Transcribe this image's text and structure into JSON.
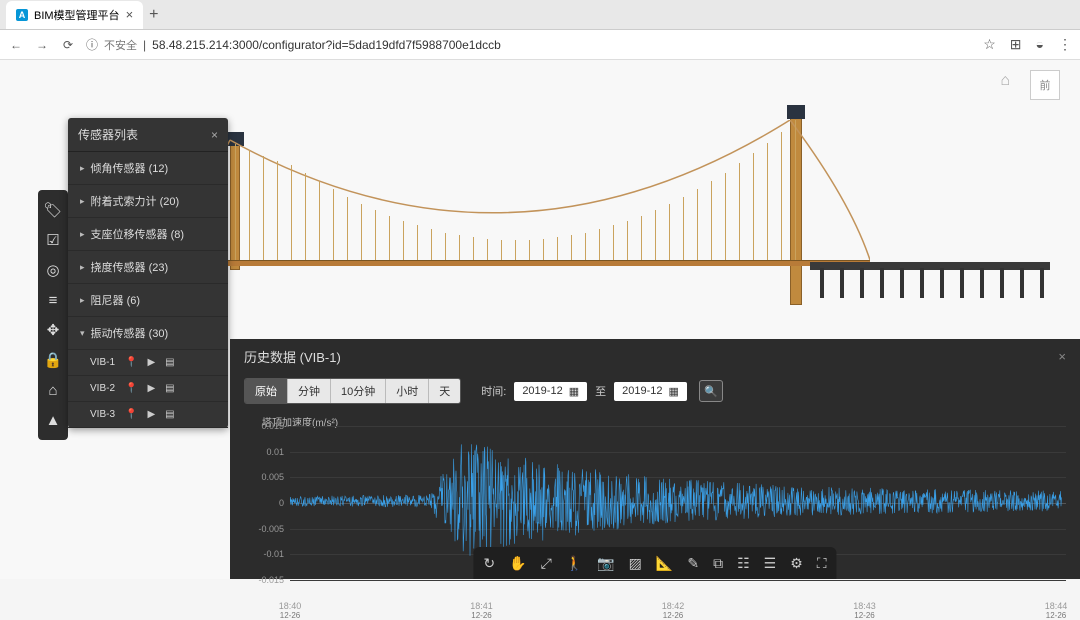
{
  "browser": {
    "tab_title": "BIM模型管理平台",
    "url_warn": "不安全",
    "url": "58.48.215.214:3000/configurator?id=5dad19dfd7f5988700e1dccb"
  },
  "cube_label": "前",
  "sensor_panel": {
    "title": "传感器列表",
    "categories": [
      {
        "label": "倾角传感器",
        "count": "(12)"
      },
      {
        "label": "附着式索力计",
        "count": "(20)"
      },
      {
        "label": "支座位移传感器",
        "count": "(8)"
      },
      {
        "label": "挠度传感器",
        "count": "(23)"
      },
      {
        "label": "阻尼器",
        "count": "(6)"
      },
      {
        "label": "振动传感器",
        "count": "(30)"
      }
    ],
    "items": [
      {
        "name": "VIB-1"
      },
      {
        "name": "VIB-2"
      },
      {
        "name": "VIB-3"
      }
    ]
  },
  "data_panel": {
    "title": "历史数据  (VIB-1)",
    "granularity": [
      "原始",
      "分钟",
      "10分钟",
      "小时",
      "天"
    ],
    "active_gran": 0,
    "time_label": "时间:",
    "date_from": "2019-12",
    "date_to": "2019-12",
    "to_sep": "至"
  },
  "chart_data": {
    "type": "line",
    "title": "",
    "ylabel": "塔顶加速度(m/s²)",
    "xlabel": "",
    "ylim": [
      -0.015,
      0.015
    ],
    "y_ticks": [
      0.015,
      0.01,
      0.005,
      0,
      -0.005,
      -0.01,
      -0.015
    ],
    "x_ticks": [
      "18:40",
      "18:41",
      "18:42",
      "18:43",
      "18:44"
    ],
    "x_sub": "12-26",
    "description": "High-frequency acceleration time-series; near-zero amplitude (~±0.001) from 18:40 to ~18:40:50, burst of large amplitude peaking around ±0.012 near 18:41, gradually decaying to ~±0.003 by 18:42 and ~±0.002 thereafter through 18:44.",
    "envelope": [
      {
        "t": 0.0,
        "a": 0.001
      },
      {
        "t": 0.18,
        "a": 0.0012
      },
      {
        "t": 0.2,
        "a": 0.006
      },
      {
        "t": 0.22,
        "a": 0.012
      },
      {
        "t": 0.25,
        "a": 0.011
      },
      {
        "t": 0.28,
        "a": 0.0095
      },
      {
        "t": 0.32,
        "a": 0.008
      },
      {
        "t": 0.38,
        "a": 0.0065
      },
      {
        "t": 0.45,
        "a": 0.005
      },
      {
        "t": 0.55,
        "a": 0.0038
      },
      {
        "t": 0.65,
        "a": 0.003
      },
      {
        "t": 0.78,
        "a": 0.0025
      },
      {
        "t": 0.9,
        "a": 0.0022
      },
      {
        "t": 1.0,
        "a": 0.002
      }
    ]
  }
}
